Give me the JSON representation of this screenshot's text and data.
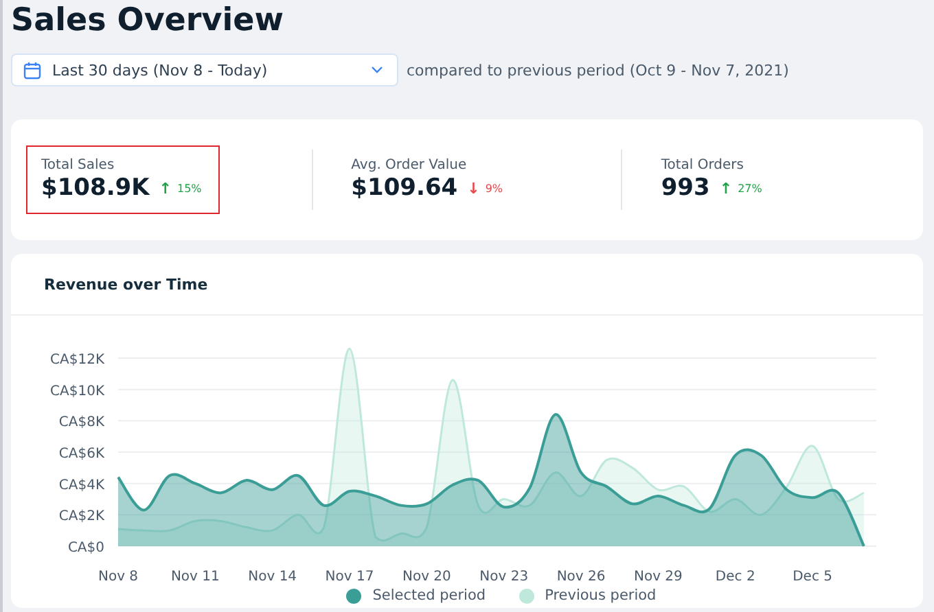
{
  "title": "Sales Overview",
  "date_range": {
    "value": "Last 30 days (Nov 8 - Today)",
    "comparison": "compared to previous period (Oct 9 - Nov 7, 2021)"
  },
  "stats": [
    {
      "label": "Total Sales",
      "value": "$108.9K",
      "arrow": "↑",
      "change": "15%",
      "color": "#22a34a",
      "highlighted": true
    },
    {
      "label": "Avg. Order Value",
      "value": "$109.64",
      "arrow": "↓",
      "change": "9%",
      "color": "#e5484d",
      "highlighted": false
    },
    {
      "label": "Total Orders",
      "value": "993",
      "arrow": "↑",
      "change": "27%",
      "color": "#22a34a",
      "highlighted": false
    }
  ],
  "chart": {
    "title": "Revenue over Time",
    "y_axis_labels": [
      "CA$12K",
      "CA$10K",
      "CA$8K",
      "CA$6K",
      "CA$4K",
      "CA$2K",
      "CA$0"
    ],
    "x_axis_labels": [
      "Nov 8",
      "Nov 11",
      "Nov 14",
      "Nov 17",
      "Nov 20",
      "Nov 23",
      "Nov 26",
      "Nov 29",
      "Dec 2",
      "Dec 5"
    ],
    "legend": [
      {
        "name": "Selected period",
        "color": "#3a9e96"
      },
      {
        "name": "Previous period",
        "color": "#bfe8dd"
      }
    ]
  }
}
